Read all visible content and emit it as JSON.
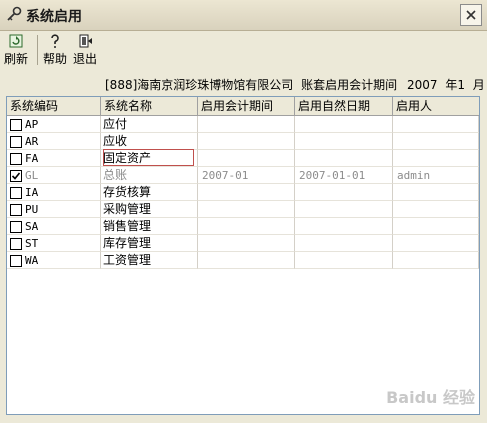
{
  "window": {
    "title": "系统启用"
  },
  "toolbar": {
    "refresh_label": "刷新",
    "help_label": "帮助",
    "exit_label": "退出"
  },
  "info": {
    "company": "[888]海南京润珍珠博物馆有限公司",
    "period_label": "账套启用会计期间",
    "year": "2007",
    "year_unit": "年1",
    "month_unit": "月"
  },
  "table": {
    "columns": [
      "系统编码",
      "系统名称",
      "启用会计期间",
      "启用自然日期",
      "启用人"
    ],
    "rows": [
      {
        "code": "AP",
        "name": "应付",
        "period": "",
        "date": "",
        "user": "",
        "checked": false
      },
      {
        "code": "AR",
        "name": "应收",
        "period": "",
        "date": "",
        "user": "",
        "checked": false
      },
      {
        "code": "FA",
        "name": "固定资产",
        "period": "",
        "date": "",
        "user": "",
        "checked": false
      },
      {
        "code": "GL",
        "name": "总账",
        "period": "2007-01",
        "date": "2007-01-01",
        "user": "admin",
        "checked": true
      },
      {
        "code": "IA",
        "name": "存货核算",
        "period": "",
        "date": "",
        "user": "",
        "checked": false
      },
      {
        "code": "PU",
        "name": "采购管理",
        "period": "",
        "date": "",
        "user": "",
        "checked": false
      },
      {
        "code": "SA",
        "name": "销售管理",
        "period": "",
        "date": "",
        "user": "",
        "checked": false
      },
      {
        "code": "ST",
        "name": "库存管理",
        "period": "",
        "date": "",
        "user": "",
        "checked": false
      },
      {
        "code": "WA",
        "name": "工资管理",
        "period": "",
        "date": "",
        "user": "",
        "checked": false
      }
    ]
  },
  "watermark": "Baidu 经验"
}
